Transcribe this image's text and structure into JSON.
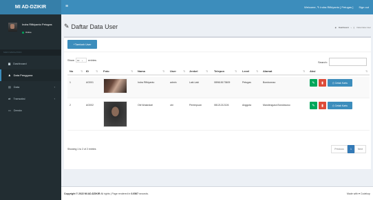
{
  "app": {
    "logo": "MI AD-DZIKIR",
    "menu_icon": "≡"
  },
  "topbar": {
    "welcome": "Welcome, ✎ Indra Rifkiyanto [ Petugas ]",
    "signout": "Sign out"
  },
  "sidebar": {
    "user": {
      "name": "Indra Rifkiyanto Petugas",
      "status": "Online"
    },
    "nav_header": "MAIN NAVIGATION",
    "items": [
      {
        "label": "Dashboard",
        "icon": "dashboard-icon"
      },
      {
        "label": "Data Pengguna",
        "icon": "user-icon",
        "active": true
      },
      {
        "label": "Data",
        "icon": "data-icon",
        "chevron": "‹"
      },
      {
        "label": "Transaksi",
        "icon": "transaction-icon",
        "chevron": "‹"
      },
      {
        "label": "Denda",
        "icon": "fine-icon"
      }
    ]
  },
  "page": {
    "title": "Daftar Data User",
    "breadcrumb": [
      "Dashboard",
      "Data Data User"
    ]
  },
  "box": {
    "add_button": "+Tambah User",
    "show_label": "Show",
    "show_value": "10",
    "entries_label": "entries",
    "search_label": "Search:",
    "columns": [
      "No",
      "ID",
      "Foto",
      "Nama",
      "User",
      "Jenkel",
      "Telepon",
      "Level",
      "Alamat",
      "Aksi"
    ],
    "rows": [
      {
        "no": "1",
        "id": "AG001",
        "nama": "Indra Rifkiyanto",
        "user": "admin",
        "jenkel": "Laki-Laki",
        "telepon": "089618173609",
        "level": "Petugas",
        "alamat": "Bondowoso"
      },
      {
        "no": "2",
        "id": "AG002",
        "nama": "Obi Wulandari",
        "user": "obi",
        "jenkel": "Perempuan",
        "telepon": "08121212126",
        "level": "Anggota",
        "alamat": "Mandiraguna Bondowoso"
      }
    ],
    "action_print": "Cetak Kartu",
    "info": "Showing 1 to 2 of 2 entries",
    "pager": {
      "prev": "Previous",
      "page": "1",
      "next": "Next"
    }
  },
  "footer": {
    "copyright_bold": "Copyright © 2022 MI AD-DZIKIR",
    "copyright_rest": " All rights | Page rendered in ",
    "render_time": "0.0567",
    "render_suffix": " seconds.",
    "made_with": "Made with ♥ Codekop"
  },
  "colors": {
    "primary": "#3c8dbc",
    "logo_bg": "#367fa9",
    "sidebar": "#222d32",
    "success": "#00a65a",
    "danger": "#dd4b39"
  }
}
